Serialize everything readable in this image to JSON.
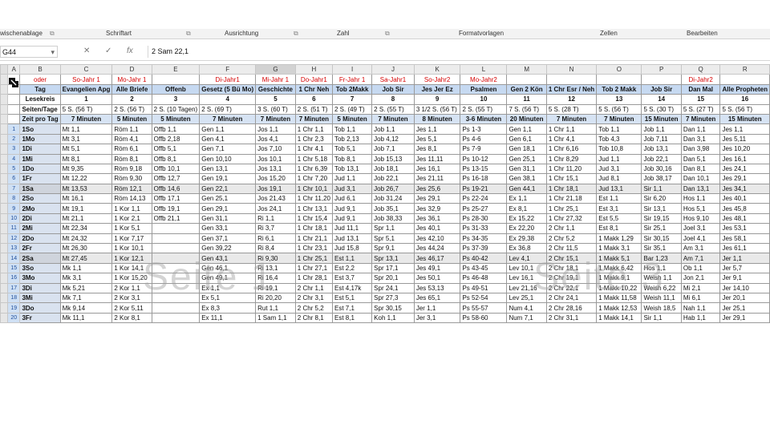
{
  "ribbon": {
    "groups": [
      "wischenablage",
      "Schriftart",
      "Ausrichtung",
      "Zahl",
      "Formatvorlagen",
      "Zellen",
      "Bearbeiten"
    ],
    "launcher_glyph": "⧉"
  },
  "formula_bar": {
    "name_box": "G44",
    "name_box_arrow": "▾",
    "cancel_glyph": "✕",
    "enter_glyph": "✓",
    "fx_glyph": "fx",
    "content": "2 Sam 22,1"
  },
  "columns": [
    "A",
    "B",
    "C",
    "D",
    "E",
    "F",
    "G",
    "H",
    "I",
    "J",
    "K",
    "L",
    "M",
    "N",
    "O",
    "P",
    "Q",
    "R"
  ],
  "selected_column": "G",
  "red_row": [
    "oder",
    "So-Jahr 1",
    "Mo-Jahr 1",
    "",
    "Di-Jahr1",
    "Mi-Jahr 1",
    "Do-Jahr1",
    "Fr-Jahr 1",
    "Sa-Jahr1",
    "So-Jahr2",
    "Mo-Jahr2",
    "",
    "",
    "",
    "",
    "Di-Jahr2",
    ""
  ],
  "header_row": [
    "Tag",
    "Evangelien Apg",
    "Alle Briefe",
    "Offenb",
    "Gesetz (5 Bü Mo)",
    "Geschichte",
    "1 Chr Neh",
    "Tob 2Makk",
    "Job Sir",
    "Jes Jer Ez",
    "Psalmen",
    "Gen 2 Kön",
    "1 Chr Esr / Neh",
    "Tob 2 Makk",
    "Job Sir",
    "Dan Mal",
    "Alle Propheten"
  ],
  "lesekreis_row": [
    "Lesekreis",
    "1",
    "2",
    "3",
    "4",
    "5",
    "6",
    "7",
    "8",
    "9",
    "10",
    "11",
    "12",
    "13",
    "14",
    "15",
    "16"
  ],
  "seiten_row": [
    "Seiten/Tage",
    "5 S. (56 T)",
    "2 S. (56 T)",
    "2 S. (10 Tagen)",
    "2 S. (69 T)",
    "3 S. (60 T)",
    "2 S. (51 T)",
    "2 S. (49 T)",
    "2 S. (55 T)",
    "3 1/2 S. (56 T)",
    "2 S. (55 T)",
    "7 S. (56 T)",
    "5 S. (28 T)",
    "5 S. (56 T)",
    "5 S. (30 T)",
    "5 S. (27 T)",
    "5 S. (56 T)"
  ],
  "zeit_row": [
    "Zeit pro Tag",
    "7 Minuten",
    "5 Minuten",
    "5 Minuten",
    "7 Minuten",
    "7 Minuten",
    "7 Minuten",
    "5 Minuten",
    "7 Minuten",
    "8 Minuten",
    "3-6 Minuten",
    "20 Minuten",
    "7 Minuten",
    "7 Minuten",
    "15 Minuten",
    "7 Minuten",
    "15 Minuten"
  ],
  "data_rows": [
    {
      "n": "1",
      "cells": [
        "1So",
        "Mt 1,1",
        "Röm 1,1",
        "Offb 1,1",
        "Gen 1,1",
        "Jos 1,1",
        "1 Chr 1,1",
        "Tob 1,1",
        "Job 1,1",
        "Jes 1,1",
        "Ps 1-3",
        "Gen 1,1",
        "1 Chr 1,1",
        "Tob 1,1",
        "Job 1,1",
        "Dan 1,1",
        "Jes 1,1"
      ]
    },
    {
      "n": "2",
      "cells": [
        "1Mo",
        "Mt 3,1",
        "Röm 4,1",
        "Offb 2,18",
        "Gen 4,1",
        "Jos 4,1",
        "1 Chr 2,3",
        "Tob 2,13",
        "Job 4,12",
        "Jes 5,1",
        "Ps 4-6",
        "Gen 6,1",
        "1 Chr 4,1",
        "Tob 4,3",
        "Job 7,11",
        "Dan 3,1",
        "Jes 5,11"
      ]
    },
    {
      "n": "3",
      "cells": [
        "1Di",
        "Mt 5,1",
        "Röm 6,1",
        "Offb 5,1",
        "Gen 7,1",
        "Jos 7,10",
        "1 Chr 4,1",
        "Tob 5,1",
        "Job 7,1",
        "Jes 8,1",
        "Ps 7-9",
        "Gen 18,1",
        "1 Chr 6,16",
        "Tob 10,8",
        "Job 13,1",
        "Dan 3,98",
        "Jes 10,20"
      ]
    },
    {
      "n": "4",
      "cells": [
        "1Mi",
        "Mt 8,1",
        "Röm 8,1",
        "Offb 8,1",
        "Gen 10,10",
        "Jos 10,1",
        "1 Chr 5,18",
        "Tob 8,1",
        "Job 15,13",
        "Jes 11,11",
        "Ps 10-12",
        "Gen 25,1",
        "1 Chr 8,29",
        "Jud 1,1",
        "Job 22,1",
        "Dan 5,1",
        "Jes 16,1"
      ]
    },
    {
      "n": "5",
      "cells": [
        "1Do",
        "Mt 9,35",
        "Röm 9,18",
        "Offb 10,1",
        "Gen 13,1",
        "Jos 13,1",
        "1 Chr 6,39",
        "Tob 13,1",
        "Job 18,1",
        "Jes 16,1",
        "Ps 13-15",
        "Gen 31,1",
        "1 Chr 11,20",
        "Jud 3,1",
        "Job 30,16",
        "Dan 8,1",
        "Jes 24,1"
      ]
    },
    {
      "n": "6",
      "cells": [
        "1Fr",
        "Mt 12,22",
        "Röm 9,30",
        "Offb 12,7",
        "Gen 19,1",
        "Jos 15,20",
        "1 Chr 7,20",
        "Jud 1,1",
        "Job 22,1",
        "Jes 21,11",
        "Ps 16-18",
        "Gen 38,1",
        "1 Chr 15,1",
        "Jud 8,1",
        "Job 38,17",
        "Dan 10,1",
        "Jes 29,1"
      ]
    },
    {
      "n": "7",
      "cells": [
        "1Sa",
        "Mt 13,53",
        "Röm 12,1",
        "Offb 14,6",
        "Gen 22,1",
        "Jos 19,1",
        "1 Chr 10,1",
        "Jud 3,1",
        "Job 26,7",
        "Jes 25,6",
        "Ps 19-21",
        "Gen 44,1",
        "1 Chr 18,1",
        "Jud 13,1",
        "Sir 1,1",
        "Dan 13,1",
        "Jes 34,1"
      ]
    },
    {
      "n": "8",
      "cells": [
        "2So",
        "Mt 16,1",
        "Röm 14,13",
        "Offb 17,1",
        "Gen 25,1",
        "Jos 21,43",
        "1 Chr 11,20",
        "Jud 6,1",
        "Job 31,24",
        "Jes 29,1",
        "Ps 22-24",
        "Ex 1,1",
        "1 Chr 21,18",
        "Est 1,1",
        "Sir 6,20",
        "Hos 1,1",
        "Jes 40,1"
      ]
    },
    {
      "n": "9",
      "cells": [
        "2Mo",
        "Mt 19,1",
        "1 Kor 1,1",
        "Offb 19,1",
        "Gen 29,1",
        "Jos 24,1",
        "1 Chr 13,1",
        "Jud 9,1",
        "Job 35,1",
        "Jes 32,9",
        "Ps 25-27",
        "Ex 8,1",
        "1 Chr 25,1",
        "Est 3,1",
        "Sir 13,1",
        "Hos 5,1",
        "Jes 45,8"
      ]
    },
    {
      "n": "10",
      "cells": [
        "2Di",
        "Mt 21,1",
        "1 Kor 2,1",
        "Offb 21,1",
        "Gen 31,1",
        "Ri 1,1",
        "1 Chr 15,4",
        "Jud 9,1",
        "Job 38,33",
        "Jes 36,1",
        "Ps 28-30",
        "Ex 15,22",
        "1 Chr 27,32",
        "Est 5,5",
        "Sir 19,15",
        "Hos 9,10",
        "Jes 48,1"
      ]
    },
    {
      "n": "11",
      "cells": [
        "2Mi",
        "Mt 22,34",
        "1 Kor 5,1",
        "",
        "Gen 33,1",
        "Ri 3,7",
        "1 Chr 18,1",
        "Jud 11,1",
        "Spr 1,1",
        "Jes 40,1",
        "Ps 31-33",
        "Ex 22,20",
        "2 Chr 1,1",
        "Est 8,1",
        "Sir 25,1",
        "Joel 3,1",
        "Jes 53,1"
      ]
    },
    {
      "n": "12",
      "cells": [
        "2Do",
        "Mt 24,32",
        "1 Kor 7,17",
        "",
        "Gen 37,1",
        "Ri 6,1",
        "1 Chr 21,1",
        "Jud 13,1",
        "Spr 5,1",
        "Jes 42,10",
        "Ps 34-35",
        "Ex 29,38",
        "2 Chr 5,2",
        "1 Makk 1,29",
        "Sir 30,15",
        "Joel 4,1",
        "Jes 58,1"
      ]
    },
    {
      "n": "13",
      "cells": [
        "2Fr",
        "Mt 26,30",
        "1 Kor 10,1",
        "",
        "Gen 39,22",
        "Ri 8,4",
        "1 Chr 23,1",
        "Jud 15,8",
        "Spr 9,1",
        "Jes 44,24",
        "Ps 37-39",
        "Ex 36,8",
        "2 Chr 11,5",
        "1 Makk 3,1",
        "Sir 35,1",
        "Am 3,1",
        "Jes 61,1"
      ]
    },
    {
      "n": "14",
      "cells": [
        "2Sa",
        "Mt 27,45",
        "1 Kor 12,1",
        "",
        "Gen 43,1",
        "Ri 9,30",
        "1 Chr 25,1",
        "Est 1,1",
        "Spr 13,1",
        "Jes 46,17",
        "Ps 40-42",
        "Lev 4,1",
        "2 Chr 15,1",
        "1 Makk 5,1",
        "Bar 1,23",
        "Am 7,1",
        "Jer 1,1"
      ]
    },
    {
      "n": "15",
      "cells": [
        "3So",
        "Mk 1,1",
        "1 Kor 14,1",
        "",
        "Gen 46,1",
        "Ri 13,1",
        "1 Chr 27,1",
        "Est 2,2",
        "Spr 17,1",
        "Jes 49,1",
        "Ps 43-45",
        "Lev 10,1",
        "2 Chr 18,1",
        "1 Makk 6,42",
        "Hos 1,1",
        "Ob 1,1",
        "Jer 5,7"
      ]
    },
    {
      "n": "16",
      "cells": [
        "3Mo",
        "Mk 3,1",
        "1 Kor 15,20",
        "",
        "Gen 49,1",
        "Ri 16,4",
        "1 Chr 28,1",
        "Est 3,7",
        "Spr 20,1",
        "Jes 50,1",
        "Ps 46-48",
        "Lev 16,1",
        "2 Chr 19,1",
        "1 Makk 9,1",
        "Weish 1,1",
        "Jon 2,1",
        "Jer 9,1"
      ]
    },
    {
      "n": "17",
      "cells": [
        "3Di",
        "Mk 5,21",
        "2 Kor 1,1",
        "",
        "Ex 1,1",
        "Ri 19,1",
        "2 Chr 1,1",
        "Est 4,17k",
        "Spr 24,1",
        "Jes 53,13",
        "Ps 49-51",
        "Lev 21,16",
        "2 Chr 22,1",
        "1 Makk 10,22",
        "Weish 6,22",
        "Mi 2,1",
        "Jer 14,10"
      ]
    },
    {
      "n": "18",
      "cells": [
        "3Mi",
        "Mk 7,1",
        "2 Kor 3,1",
        "",
        "Ex 5,1",
        "Ri 20,20",
        "2 Chr 3,1",
        "Est 5,1",
        "Spr 27,3",
        "Jes 65,1",
        "Ps 52-54",
        "Lev 25,1",
        "2 Chr 24,1",
        "1 Makk 11,58",
        "Weish 11,1",
        "Mi 6,1",
        "Jer 20,1"
      ]
    },
    {
      "n": "19",
      "cells": [
        "3Do",
        "Mk 9,14",
        "2 Kor 5,11",
        "",
        "Ex 8,3",
        "Rut 1,1",
        "2 Chr 5,2",
        "Est 7,1",
        "Spr 30,15",
        "Jer 1,1",
        "Ps 55-57",
        "Num 4,1",
        "2 Chr 28,16",
        "1 Makk 12,53",
        "Weish 18,5",
        "Nah 1,1",
        "Jer 25,1"
      ]
    },
    {
      "n": "20",
      "cells": [
        "3Fr",
        "Mk 11,1",
        "2 Kor 8,1",
        "",
        "Ex 11,1",
        "1 Sam 1,1",
        "2 Chr 8,1",
        "Est 8,1",
        "Koh 1,1",
        "Jer 3,1",
        "Ps 58-60",
        "Num 7,1",
        "2 Chr 31,1",
        "1 Makk 14,1",
        "Sir 1,1",
        "Hab 1,1",
        "Jer 29,1"
      ]
    }
  ],
  "watermarks": [
    "Seite 1",
    "Seite 3"
  ]
}
